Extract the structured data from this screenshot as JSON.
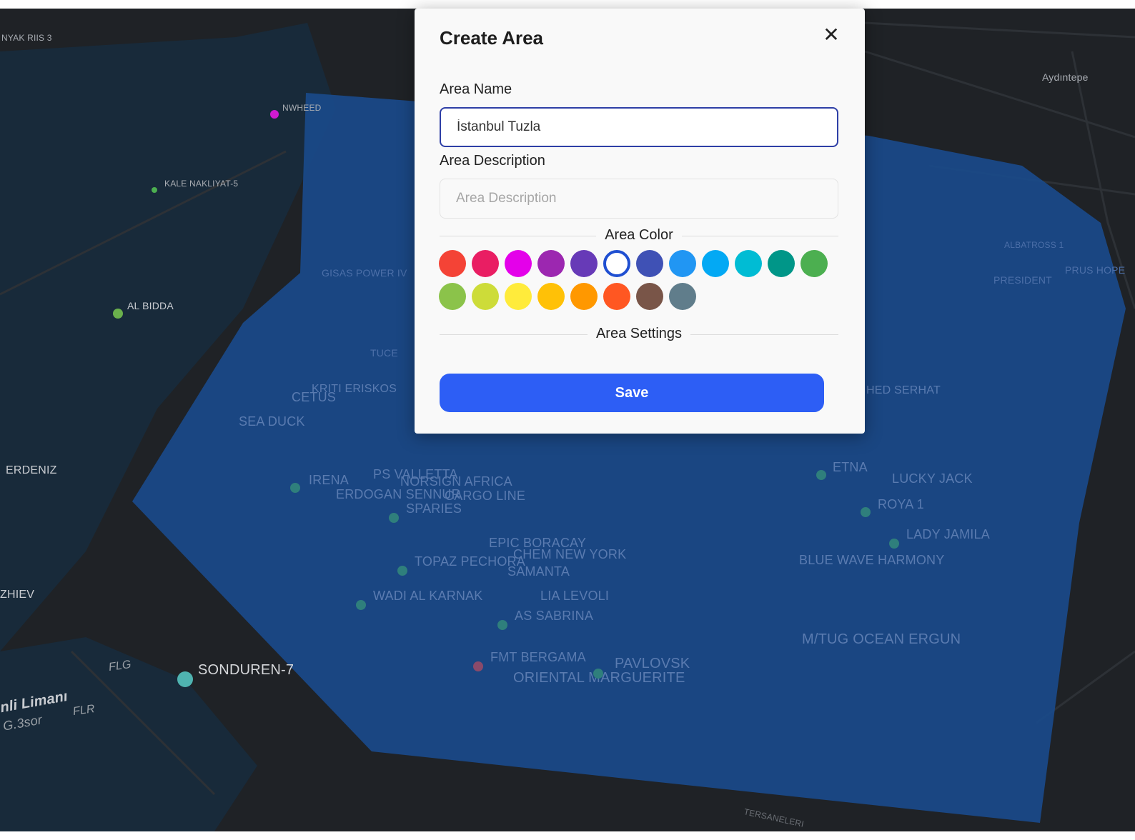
{
  "modal": {
    "title": "Create Area",
    "close_label": "✕",
    "name_label": "Area Name",
    "name_value": "İstanbul Tuzla",
    "description_label": "Area Description",
    "description_placeholder": "Area Description",
    "description_value": "",
    "color_section_label": "Area Color",
    "settings_section_label": "Area Settings",
    "save_label": "Save",
    "selected_color_index": 5,
    "colors": [
      "#f44336",
      "#e91e63",
      "#e400ea",
      "#9c27b0",
      "#673ab7",
      "#ffffff",
      "#3f51b5",
      "#2196f3",
      "#03a9f4",
      "#00bcd4",
      "#009688",
      "#4caf50",
      "#8bc34a",
      "#cddc39",
      "#ffeb3b",
      "#ffc107",
      "#ff9800",
      "#ff5722",
      "#795548",
      "#607d8b"
    ]
  },
  "map": {
    "polygon_color": "#1a4a8a",
    "labels": {
      "l1": "NYAK RIIS 3",
      "l2": "NWHEED",
      "l3": "KALE NAKLIYAT-5",
      "l4": "AL BIDDA",
      "l5": "ERDENIZ",
      "l6": "ZHIEV",
      "l7": "SONDUREN-7",
      "l8": "Aydıntepe",
      "l9": "ALBATROSS 1",
      "l10": "PRESIDENT",
      "l11": "PRUS HOPE",
      "l12": "ETNA",
      "l13": "LUCKY JACK",
      "l14": "ROYA 1",
      "l15": "LADY JAMILA",
      "l16": "BLUE WAVE HARMONY",
      "l17": "M/TUG OCEAN ERGUN",
      "l18": "IRENA",
      "l19": "PS VALLETTA",
      "l20": "NORSIGN AFRICA",
      "l21": "ERDOGAN SENNUR",
      "l22": "CARGO LINE",
      "l23": "SPARIES",
      "l24": "EPIC BORACAY",
      "l25": "TOPAZ PECHORA",
      "l26": "CHEM NEW YORK",
      "l27": "SAMANTA",
      "l28": "WADI AL KARNAK",
      "l29": "LIA LEVOLI",
      "l30": "AS SABRINA",
      "l31": "FMT BERGAMA",
      "l32": "PAVLOVSK",
      "l33": "ORIENTAL MARGUERITE",
      "l34": "SEA DUCK",
      "l35": "CETUS",
      "l36": "KRITI ERISKOS",
      "l37": "GISAS POWER IV",
      "l38": "TUCE",
      "l39": "HED SERHAT",
      "l40": "FLG",
      "l41": "FLR",
      "l42": "nli Limanı",
      "l43": "G.3sor",
      "l44": "TERSANELERI"
    }
  }
}
